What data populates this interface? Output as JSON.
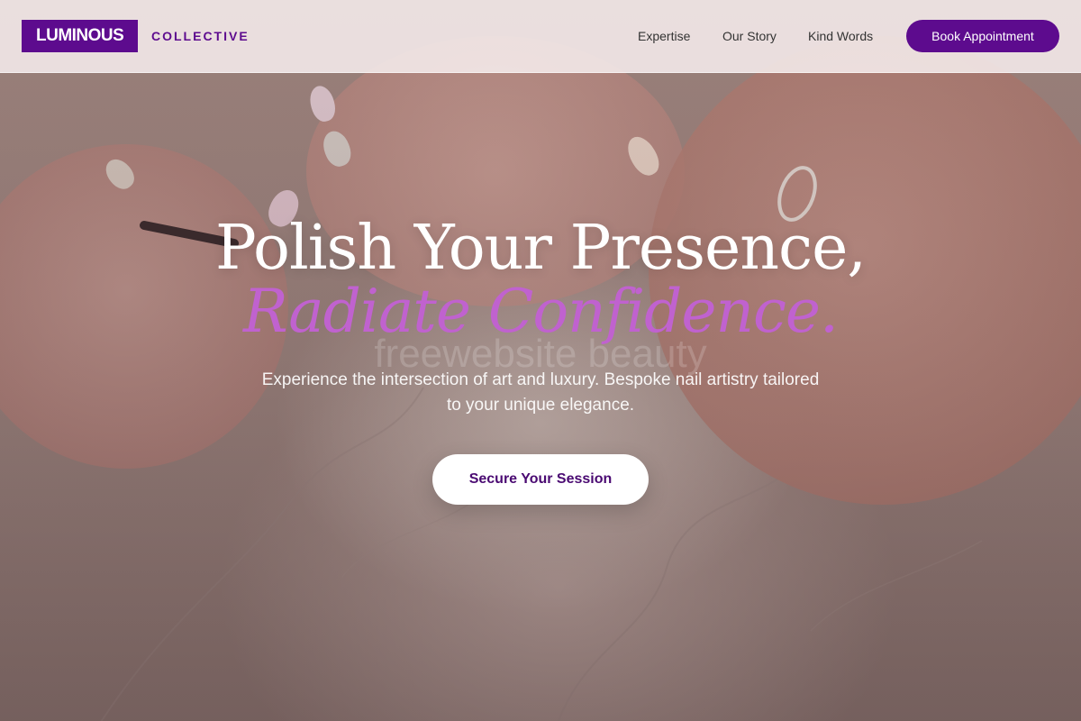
{
  "brand": {
    "name": "LUMINOUS",
    "tagline": "COLLECTIVE",
    "accent": "#5d0b8e"
  },
  "nav": {
    "items": [
      {
        "label": "Expertise"
      },
      {
        "label": "Our Story"
      },
      {
        "label": "Kind Words"
      }
    ],
    "cta_label": "Book Appointment"
  },
  "hero": {
    "headline": "Polish Your Presence,",
    "headline_accent": "Radiate Confidence.",
    "headline_accent_color": "#c062cf",
    "watermark": "freewebsite beauty",
    "subtitle": "Experience the intersection of art and luxury. Bespoke nail artistry tailored to your unique elegance.",
    "cta_label": "Secure Your Session",
    "background": "nail-artistry-hands-photo"
  }
}
